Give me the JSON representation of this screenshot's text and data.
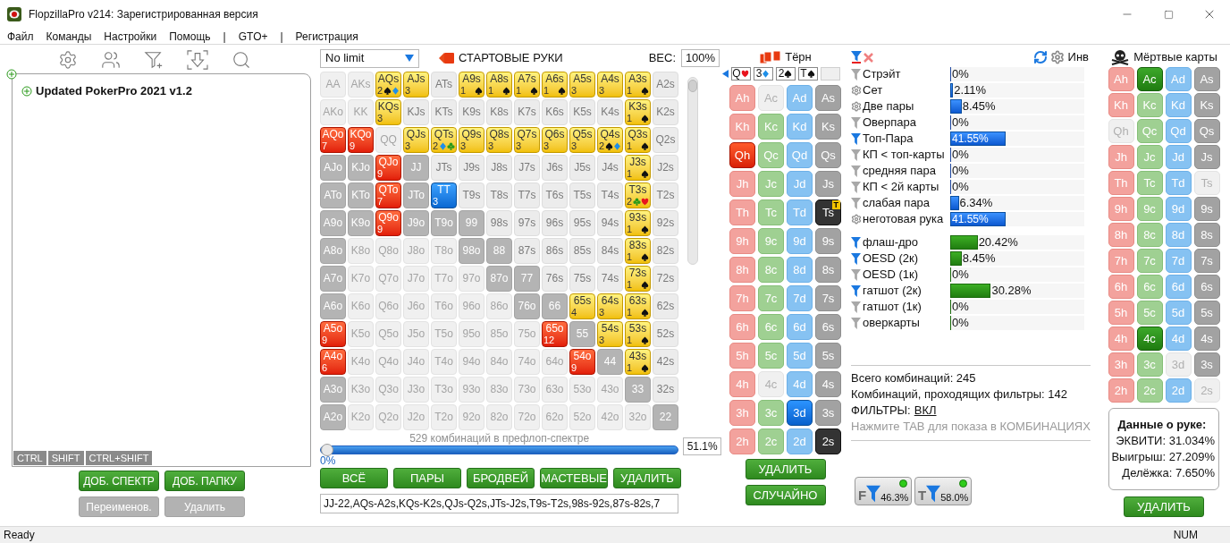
{
  "window": {
    "title": "FlopzillaPro v214: Зарегистрированная версия"
  },
  "menu": [
    "Файл",
    "Команды",
    "Настройки",
    "Помощь",
    "|",
    "GTO+",
    "|",
    "Регистрация"
  ],
  "tree": {
    "label": "Updated PokerPro 2021 v1.2",
    "expanded": false
  },
  "modifier_tabs": [
    {
      "label": "CTRL",
      "selected": false
    },
    {
      "label": "SHIFT",
      "selected": false
    },
    {
      "label": "CTRL+SHIFT",
      "selected": false
    }
  ],
  "left_buttons": [
    {
      "label": "ДОБ. СПЕКТР",
      "disabled": false
    },
    {
      "label": "ДОБ. ПАПКУ",
      "disabled": false
    },
    {
      "label": "Переименов.",
      "disabled": true
    },
    {
      "label": "Удалить",
      "disabled": true
    }
  ],
  "game_select": {
    "value": "No limit"
  },
  "grid_title": "СТАРТОВЫЕ РУКИ",
  "weight": {
    "label": "ВЕС:",
    "value": "100%"
  },
  "hands": [
    [
      {
        "label": "AA",
        "kind": "faded"
      },
      {
        "label": "AKs",
        "kind": "faded"
      },
      {
        "label": "AQs",
        "kind": "suited",
        "count": "2",
        "suits": [
          {
            "kind": "spade"
          },
          {
            "kind": "diamond"
          }
        ]
      },
      {
        "label": "AJs",
        "kind": "suited",
        "count": "3"
      },
      {
        "label": "ATs",
        "kind": "plain"
      },
      {
        "label": "A9s",
        "kind": "suited",
        "count": "1",
        "suits": [
          {
            "kind": "spade"
          }
        ]
      },
      {
        "label": "A8s",
        "kind": "suited",
        "count": "1",
        "suits": [
          {
            "kind": "spade"
          }
        ]
      },
      {
        "label": "A7s",
        "kind": "suited",
        "count": "1",
        "suits": [
          {
            "kind": "spade"
          }
        ]
      },
      {
        "label": "A6s",
        "kind": "suited",
        "count": "1",
        "suits": [
          {
            "kind": "spade"
          }
        ]
      },
      {
        "label": "A5s",
        "kind": "suited",
        "count": "3"
      },
      {
        "label": "A4s",
        "kind": "suited",
        "count": "3"
      },
      {
        "label": "A3s",
        "kind": "suited",
        "count": "1",
        "suits": [
          {
            "kind": "spade"
          }
        ]
      },
      {
        "label": "A2s",
        "kind": "plain"
      }
    ],
    [
      {
        "label": "AKo",
        "kind": "faded"
      },
      {
        "label": "KK",
        "kind": "faded"
      },
      {
        "label": "KQs",
        "kind": "suited",
        "count": "3"
      },
      {
        "label": "KJs",
        "kind": "plain"
      },
      {
        "label": "KTs",
        "kind": "plain"
      },
      {
        "label": "K9s",
        "kind": "plain"
      },
      {
        "label": "K8s",
        "kind": "plain"
      },
      {
        "label": "K7s",
        "kind": "plain"
      },
      {
        "label": "K6s",
        "kind": "plain"
      },
      {
        "label": "K5s",
        "kind": "plain"
      },
      {
        "label": "K4s",
        "kind": "plain"
      },
      {
        "label": "K3s",
        "kind": "suited",
        "count": "1",
        "suits": [
          {
            "kind": "spade"
          }
        ]
      },
      {
        "label": "K2s",
        "kind": "plain"
      }
    ],
    [
      {
        "label": "AQo",
        "kind": "offsuit",
        "count": "7"
      },
      {
        "label": "KQo",
        "kind": "offsuit",
        "count": "9"
      },
      {
        "label": "QQ",
        "kind": "faded"
      },
      {
        "label": "QJs",
        "kind": "suited",
        "count": "3"
      },
      {
        "label": "QTs",
        "kind": "suited",
        "count": "2",
        "suits": [
          {
            "kind": "diamond"
          },
          {
            "kind": "club"
          }
        ]
      },
      {
        "label": "Q9s",
        "kind": "suited",
        "count": "3"
      },
      {
        "label": "Q8s",
        "kind": "suited",
        "count": "3"
      },
      {
        "label": "Q7s",
        "kind": "suited",
        "count": "3"
      },
      {
        "label": "Q6s",
        "kind": "suited",
        "count": "3"
      },
      {
        "label": "Q5s",
        "kind": "suited",
        "count": "3"
      },
      {
        "label": "Q4s",
        "kind": "suited",
        "count": "2",
        "suits": [
          {
            "kind": "spade"
          },
          {
            "kind": "diamond"
          }
        ]
      },
      {
        "label": "Q3s",
        "kind": "suited",
        "count": "1",
        "suits": [
          {
            "kind": "spade"
          }
        ]
      },
      {
        "label": "Q2s",
        "kind": "plain"
      }
    ],
    [
      {
        "label": "AJo",
        "kind": "grey"
      },
      {
        "label": "KJo",
        "kind": "grey"
      },
      {
        "label": "QJo",
        "kind": "offsuit",
        "count": "9"
      },
      {
        "label": "JJ",
        "kind": "grey"
      },
      {
        "label": "JTs",
        "kind": "plain"
      },
      {
        "label": "J9s",
        "kind": "plain"
      },
      {
        "label": "J8s",
        "kind": "plain"
      },
      {
        "label": "J7s",
        "kind": "plain"
      },
      {
        "label": "J6s",
        "kind": "plain"
      },
      {
        "label": "J5s",
        "kind": "plain"
      },
      {
        "label": "J4s",
        "kind": "plain"
      },
      {
        "label": "J3s",
        "kind": "suited",
        "count": "1",
        "suits": [
          {
            "kind": "spade"
          }
        ]
      },
      {
        "label": "J2s",
        "kind": "plain"
      }
    ],
    [
      {
        "label": "ATo",
        "kind": "grey"
      },
      {
        "label": "KTo",
        "kind": "grey"
      },
      {
        "label": "QTo",
        "kind": "offsuit",
        "count": "7"
      },
      {
        "label": "JTo",
        "kind": "grey"
      },
      {
        "label": "TT",
        "kind": "pair",
        "count": "3"
      },
      {
        "label": "T9s",
        "kind": "plain"
      },
      {
        "label": "T8s",
        "kind": "plain"
      },
      {
        "label": "T7s",
        "kind": "plain"
      },
      {
        "label": "T6s",
        "kind": "plain"
      },
      {
        "label": "T5s",
        "kind": "plain"
      },
      {
        "label": "T4s",
        "kind": "plain"
      },
      {
        "label": "T3s",
        "kind": "suited",
        "count": "2",
        "suits": [
          {
            "kind": "club"
          },
          {
            "kind": "heart"
          }
        ]
      },
      {
        "label": "T2s",
        "kind": "plain"
      }
    ],
    [
      {
        "label": "A9o",
        "kind": "grey"
      },
      {
        "label": "K9o",
        "kind": "grey"
      },
      {
        "label": "Q9o",
        "kind": "offsuit",
        "count": "9"
      },
      {
        "label": "J9o",
        "kind": "grey"
      },
      {
        "label": "T9o",
        "kind": "grey"
      },
      {
        "label": "99",
        "kind": "grey"
      },
      {
        "label": "98s",
        "kind": "plain"
      },
      {
        "label": "97s",
        "kind": "plain"
      },
      {
        "label": "96s",
        "kind": "plain"
      },
      {
        "label": "95s",
        "kind": "plain"
      },
      {
        "label": "94s",
        "kind": "plain"
      },
      {
        "label": "93s",
        "kind": "suited",
        "count": "1",
        "suits": [
          {
            "kind": "spade"
          }
        ]
      },
      {
        "label": "92s",
        "kind": "plain"
      }
    ],
    [
      {
        "label": "A8o",
        "kind": "grey"
      },
      {
        "label": "K8o",
        "kind": "faded"
      },
      {
        "label": "Q8o",
        "kind": "faded"
      },
      {
        "label": "J8o",
        "kind": "faded"
      },
      {
        "label": "T8o",
        "kind": "faded"
      },
      {
        "label": "98o",
        "kind": "grey"
      },
      {
        "label": "88",
        "kind": "grey"
      },
      {
        "label": "87s",
        "kind": "plain"
      },
      {
        "label": "86s",
        "kind": "plain"
      },
      {
        "label": "85s",
        "kind": "plain"
      },
      {
        "label": "84s",
        "kind": "plain"
      },
      {
        "label": "83s",
        "kind": "suited",
        "count": "1",
        "suits": [
          {
            "kind": "spade"
          }
        ]
      },
      {
        "label": "82s",
        "kind": "plain"
      }
    ],
    [
      {
        "label": "A7o",
        "kind": "grey"
      },
      {
        "label": "K7o",
        "kind": "faded"
      },
      {
        "label": "Q7o",
        "kind": "faded"
      },
      {
        "label": "J7o",
        "kind": "faded"
      },
      {
        "label": "T7o",
        "kind": "faded"
      },
      {
        "label": "97o",
        "kind": "faded"
      },
      {
        "label": "87o",
        "kind": "grey"
      },
      {
        "label": "77",
        "kind": "grey"
      },
      {
        "label": "76s",
        "kind": "plain"
      },
      {
        "label": "75s",
        "kind": "plain"
      },
      {
        "label": "74s",
        "kind": "plain"
      },
      {
        "label": "73s",
        "kind": "suited",
        "count": "1",
        "suits": [
          {
            "kind": "spade"
          }
        ]
      },
      {
        "label": "72s",
        "kind": "plain"
      }
    ],
    [
      {
        "label": "A6o",
        "kind": "grey"
      },
      {
        "label": "K6o",
        "kind": "faded"
      },
      {
        "label": "Q6o",
        "kind": "faded"
      },
      {
        "label": "J6o",
        "kind": "faded"
      },
      {
        "label": "T6o",
        "kind": "faded"
      },
      {
        "label": "96o",
        "kind": "faded"
      },
      {
        "label": "86o",
        "kind": "faded"
      },
      {
        "label": "76o",
        "kind": "grey"
      },
      {
        "label": "66",
        "kind": "grey"
      },
      {
        "label": "65s",
        "kind": "suited",
        "count": "4"
      },
      {
        "label": "64s",
        "kind": "suited",
        "count": "3"
      },
      {
        "label": "63s",
        "kind": "suited",
        "count": "1",
        "suits": [
          {
            "kind": "spade"
          }
        ]
      },
      {
        "label": "62s",
        "kind": "plain"
      }
    ],
    [
      {
        "label": "A5o",
        "kind": "offsuit",
        "count": "9"
      },
      {
        "label": "K5o",
        "kind": "faded"
      },
      {
        "label": "Q5o",
        "kind": "faded"
      },
      {
        "label": "J5o",
        "kind": "faded"
      },
      {
        "label": "T5o",
        "kind": "faded"
      },
      {
        "label": "95o",
        "kind": "faded"
      },
      {
        "label": "85o",
        "kind": "faded"
      },
      {
        "label": "75o",
        "kind": "faded"
      },
      {
        "label": "65o",
        "kind": "offsuit",
        "count": "12"
      },
      {
        "label": "55",
        "kind": "grey"
      },
      {
        "label": "54s",
        "kind": "suited",
        "count": "3"
      },
      {
        "label": "53s",
        "kind": "suited",
        "count": "1",
        "suits": [
          {
            "kind": "spade"
          }
        ]
      },
      {
        "label": "52s",
        "kind": "plain"
      }
    ],
    [
      {
        "label": "A4o",
        "kind": "offsuit",
        "count": "6"
      },
      {
        "label": "K4o",
        "kind": "faded"
      },
      {
        "label": "Q4o",
        "kind": "faded"
      },
      {
        "label": "J4o",
        "kind": "faded"
      },
      {
        "label": "T4o",
        "kind": "faded"
      },
      {
        "label": "94o",
        "kind": "faded"
      },
      {
        "label": "84o",
        "kind": "faded"
      },
      {
        "label": "74o",
        "kind": "faded"
      },
      {
        "label": "64o",
        "kind": "faded"
      },
      {
        "label": "54o",
        "kind": "offsuit",
        "count": "9"
      },
      {
        "label": "44",
        "kind": "grey"
      },
      {
        "label": "43s",
        "kind": "suited",
        "count": "1",
        "suits": [
          {
            "kind": "spade"
          }
        ]
      },
      {
        "label": "42s",
        "kind": "plain"
      }
    ],
    [
      {
        "label": "A3o",
        "kind": "grey"
      },
      {
        "label": "K3o",
        "kind": "faded"
      },
      {
        "label": "Q3o",
        "kind": "faded"
      },
      {
        "label": "J3o",
        "kind": "faded"
      },
      {
        "label": "T3o",
        "kind": "faded"
      },
      {
        "label": "93o",
        "kind": "faded"
      },
      {
        "label": "83o",
        "kind": "faded"
      },
      {
        "label": "73o",
        "kind": "faded"
      },
      {
        "label": "63o",
        "kind": "faded"
      },
      {
        "label": "53o",
        "kind": "faded"
      },
      {
        "label": "43o",
        "kind": "faded"
      },
      {
        "label": "33",
        "kind": "grey"
      },
      {
        "label": "32s",
        "kind": "plain"
      }
    ],
    [
      {
        "label": "A2o",
        "kind": "grey"
      },
      {
        "label": "K2o",
        "kind": "faded"
      },
      {
        "label": "Q2o",
        "kind": "faded"
      },
      {
        "label": "J2o",
        "kind": "faded"
      },
      {
        "label": "T2o",
        "kind": "faded"
      },
      {
        "label": "92o",
        "kind": "faded"
      },
      {
        "label": "82o",
        "kind": "faded"
      },
      {
        "label": "72o",
        "kind": "faded"
      },
      {
        "label": "62o",
        "kind": "faded"
      },
      {
        "label": "52o",
        "kind": "faded"
      },
      {
        "label": "42o",
        "kind": "faded"
      },
      {
        "label": "32o",
        "kind": "faded"
      },
      {
        "label": "22",
        "kind": "grey"
      }
    ]
  ],
  "preflop": {
    "label": "529 комбинаций в префлоп-спектре",
    "min_label": "0%",
    "level": 0,
    "value": "51.1%"
  },
  "range_buttons": [
    "ВСЁ",
    "ПАРЫ",
    "БРОДВЕЙ",
    "МАСТЕВЫЕ",
    "УДАЛИТЬ"
  ],
  "range_text": "JJ-22,AQs-A2s,KQs-K2s,QJs-Q2s,JTs-J2s,T9s-T2s,98s-92s,87s-82s,7",
  "street": "Тёрн",
  "board": [
    {
      "rank": "Q",
      "kind": "heart"
    },
    {
      "rank": "3",
      "kind": "diamond"
    },
    {
      "rank": "2",
      "kind": "spade"
    },
    {
      "rank": "T",
      "kind": "spade"
    }
  ],
  "turn_cards": [
    [
      {
        "label": "Ah",
        "kind": "normal"
      },
      {
        "label": "Ac",
        "kind": "used"
      },
      {
        "label": "Ad",
        "kind": "normal"
      },
      {
        "label": "As",
        "kind": "normal"
      }
    ],
    [
      {
        "label": "Kh",
        "kind": "normal"
      },
      {
        "label": "Kc",
        "kind": "normal"
      },
      {
        "label": "Kd",
        "kind": "normal"
      },
      {
        "label": "Ks",
        "kind": "normal"
      }
    ],
    [
      {
        "label": "Qh",
        "kind": "picked"
      },
      {
        "label": "Qc",
        "kind": "normal"
      },
      {
        "label": "Qd",
        "kind": "normal"
      },
      {
        "label": "Qs",
        "kind": "normal"
      }
    ],
    [
      {
        "label": "Jh",
        "kind": "normal"
      },
      {
        "label": "Jc",
        "kind": "normal"
      },
      {
        "label": "Jd",
        "kind": "normal"
      },
      {
        "label": "Js",
        "kind": "normal"
      }
    ],
    [
      {
        "label": "Th",
        "kind": "normal"
      },
      {
        "label": "Tc",
        "kind": "normal"
      },
      {
        "label": "Td",
        "kind": "normal"
      },
      {
        "label": "Ts",
        "kind": "board",
        "badge": "T"
      }
    ],
    [
      {
        "label": "9h",
        "kind": "normal"
      },
      {
        "label": "9c",
        "kind": "normal"
      },
      {
        "label": "9d",
        "kind": "normal"
      },
      {
        "label": "9s",
        "kind": "normal"
      }
    ],
    [
      {
        "label": "8h",
        "kind": "normal"
      },
      {
        "label": "8c",
        "kind": "normal"
      },
      {
        "label": "8d",
        "kind": "normal"
      },
      {
        "label": "8s",
        "kind": "normal"
      }
    ],
    [
      {
        "label": "7h",
        "kind": "normal"
      },
      {
        "label": "7c",
        "kind": "normal"
      },
      {
        "label": "7d",
        "kind": "normal"
      },
      {
        "label": "7s",
        "kind": "normal"
      }
    ],
    [
      {
        "label": "6h",
        "kind": "normal"
      },
      {
        "label": "6c",
        "kind": "normal"
      },
      {
        "label": "6d",
        "kind": "normal"
      },
      {
        "label": "6s",
        "kind": "normal"
      }
    ],
    [
      {
        "label": "5h",
        "kind": "normal"
      },
      {
        "label": "5c",
        "kind": "normal"
      },
      {
        "label": "5d",
        "kind": "normal"
      },
      {
        "label": "5s",
        "kind": "normal"
      }
    ],
    [
      {
        "label": "4h",
        "kind": "normal"
      },
      {
        "label": "4c",
        "kind": "used"
      },
      {
        "label": "4d",
        "kind": "normal"
      },
      {
        "label": "4s",
        "kind": "normal"
      }
    ],
    [
      {
        "label": "3h",
        "kind": "normal"
      },
      {
        "label": "3c",
        "kind": "normal"
      },
      {
        "label": "3d",
        "kind": "picked"
      },
      {
        "label": "3s",
        "kind": "normal"
      }
    ],
    [
      {
        "label": "2h",
        "kind": "normal"
      },
      {
        "label": "2c",
        "kind": "normal"
      },
      {
        "label": "2d",
        "kind": "normal"
      },
      {
        "label": "2s",
        "kind": "board"
      }
    ]
  ],
  "turn_buttons": [
    "УДАЛИТЬ",
    "СЛУЧАЙНО"
  ],
  "invert_label": "Инв",
  "made_hands": [
    {
      "kind": "filter",
      "active": false,
      "label": "Стрэйт",
      "level": 0,
      "value": "0%"
    },
    {
      "kind": "gear",
      "active": false,
      "label": "Сет",
      "level": 0.0211,
      "value": "2.11%"
    },
    {
      "kind": "gear",
      "active": false,
      "label": "Две пары",
      "level": 0.0845,
      "value": "8.45%"
    },
    {
      "kind": "filter",
      "active": false,
      "label": "Оверпара",
      "level": 0,
      "value": "0%"
    },
    {
      "kind": "filter",
      "active": true,
      "label": "Топ-Пара",
      "level": 0.4155,
      "value": "41.55%"
    },
    {
      "kind": "filter",
      "active": false,
      "label": "КП < топ-карты",
      "level": 0,
      "value": "0%"
    },
    {
      "kind": "filter",
      "active": false,
      "label": "средняя пара",
      "level": 0,
      "value": "0%"
    },
    {
      "kind": "filter",
      "active": false,
      "label": "КП < 2й карты",
      "level": 0,
      "value": "0%"
    },
    {
      "kind": "filter",
      "active": false,
      "label": "слабая пара",
      "level": 0.0634,
      "value": "6.34%"
    },
    {
      "kind": "gear",
      "active": false,
      "label": "неготовая рука",
      "level": 0.4155,
      "value": "41.55%"
    }
  ],
  "draws": [
    {
      "active": true,
      "label": "флаш-дро",
      "level": 0.2042,
      "value": "20.42%"
    },
    {
      "active": true,
      "label": "OESD (2к)",
      "level": 0.0845,
      "value": "8.45%"
    },
    {
      "active": false,
      "label": "OESD (1к)",
      "level": 0,
      "value": "0%"
    },
    {
      "active": true,
      "label": "гатшот (2к)",
      "level": 0.3028,
      "value": "30.28%"
    },
    {
      "active": false,
      "label": "гатшот (1к)",
      "level": 0,
      "value": "0%"
    },
    {
      "active": false,
      "label": "оверкарты",
      "level": 0,
      "value": "0%"
    }
  ],
  "summary": {
    "total": "Всего комбинаций: 245",
    "passing": "Комбинаций, проходящих фильтры: 142",
    "filters_label": "ФИЛЬТРЫ:",
    "filters_value": "ВКЛ",
    "hint": "Нажмите TAB для показа в КОМБИНАЦИЯХ"
  },
  "filter_presets": [
    {
      "letter": "F",
      "value": "46.3%",
      "on": true
    },
    {
      "letter": "T",
      "value": "58.0%",
      "on": true
    }
  ],
  "dead_title": "Мёртвые карты",
  "dead_cards": [
    [
      {
        "label": "Ah",
        "kind": "normal"
      },
      {
        "label": "Ac",
        "kind": "dead"
      },
      {
        "label": "Ad",
        "kind": "normal"
      },
      {
        "label": "As",
        "kind": "normal"
      }
    ],
    [
      {
        "label": "Kh",
        "kind": "normal"
      },
      {
        "label": "Kc",
        "kind": "normal"
      },
      {
        "label": "Kd",
        "kind": "normal"
      },
      {
        "label": "Ks",
        "kind": "normal"
      }
    ],
    [
      {
        "label": "Qh",
        "kind": "used"
      },
      {
        "label": "Qc",
        "kind": "normal"
      },
      {
        "label": "Qd",
        "kind": "normal"
      },
      {
        "label": "Qs",
        "kind": "normal"
      }
    ],
    [
      {
        "label": "Jh",
        "kind": "normal"
      },
      {
        "label": "Jc",
        "kind": "normal"
      },
      {
        "label": "Jd",
        "kind": "normal"
      },
      {
        "label": "Js",
        "kind": "normal"
      }
    ],
    [
      {
        "label": "Th",
        "kind": "normal"
      },
      {
        "label": "Tc",
        "kind": "normal"
      },
      {
        "label": "Td",
        "kind": "normal"
      },
      {
        "label": "Ts",
        "kind": "used"
      }
    ],
    [
      {
        "label": "9h",
        "kind": "normal"
      },
      {
        "label": "9c",
        "kind": "normal"
      },
      {
        "label": "9d",
        "kind": "normal"
      },
      {
        "label": "9s",
        "kind": "normal"
      }
    ],
    [
      {
        "label": "8h",
        "kind": "normal"
      },
      {
        "label": "8c",
        "kind": "normal"
      },
      {
        "label": "8d",
        "kind": "normal"
      },
      {
        "label": "8s",
        "kind": "normal"
      }
    ],
    [
      {
        "label": "7h",
        "kind": "normal"
      },
      {
        "label": "7c",
        "kind": "normal"
      },
      {
        "label": "7d",
        "kind": "normal"
      },
      {
        "label": "7s",
        "kind": "normal"
      }
    ],
    [
      {
        "label": "6h",
        "kind": "normal"
      },
      {
        "label": "6c",
        "kind": "normal"
      },
      {
        "label": "6d",
        "kind": "normal"
      },
      {
        "label": "6s",
        "kind": "normal"
      }
    ],
    [
      {
        "label": "5h",
        "kind": "normal"
      },
      {
        "label": "5c",
        "kind": "normal"
      },
      {
        "label": "5d",
        "kind": "normal"
      },
      {
        "label": "5s",
        "kind": "normal"
      }
    ],
    [
      {
        "label": "4h",
        "kind": "normal"
      },
      {
        "label": "4c",
        "kind": "dead"
      },
      {
        "label": "4d",
        "kind": "normal"
      },
      {
        "label": "4s",
        "kind": "normal"
      }
    ],
    [
      {
        "label": "3h",
        "kind": "normal"
      },
      {
        "label": "3c",
        "kind": "normal"
      },
      {
        "label": "3d",
        "kind": "used"
      },
      {
        "label": "3s",
        "kind": "normal"
      }
    ],
    [
      {
        "label": "2h",
        "kind": "normal"
      },
      {
        "label": "2c",
        "kind": "normal"
      },
      {
        "label": "2d",
        "kind": "normal"
      },
      {
        "label": "2s",
        "kind": "used"
      }
    ]
  ],
  "hand_info": {
    "title": "Данные о руке:",
    "lines": [
      "ЭКВИТИ: 31.034%",
      "Выигрыш: 27.209%",
      "Делёжка: 7.650%"
    ]
  },
  "dead_button": "УДАЛИТЬ",
  "status_bar": {
    "left": "Ready",
    "right": "NUM"
  }
}
